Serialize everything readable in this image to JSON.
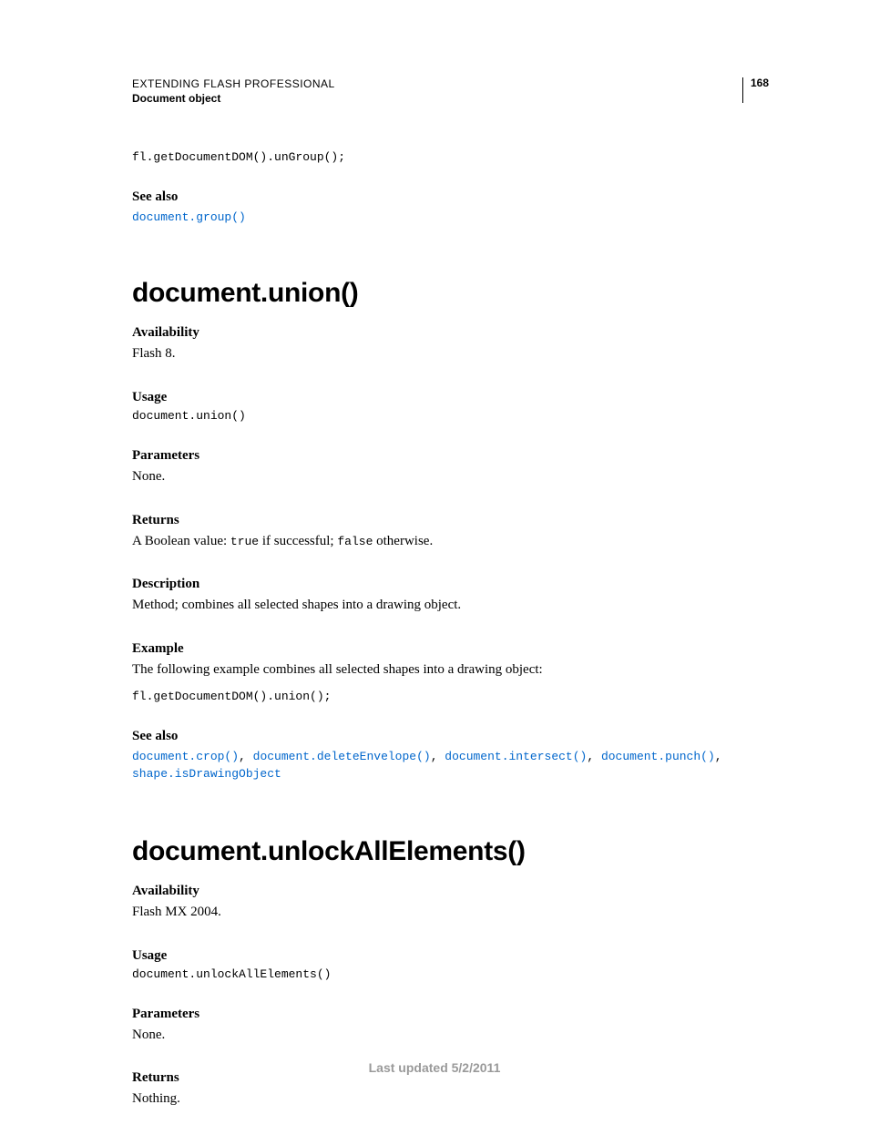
{
  "header": {
    "title": "EXTENDING FLASH PROFESSIONAL",
    "subtitle": "Document object",
    "page": "168"
  },
  "top_code": "fl.getDocumentDOM().unGroup();",
  "top_seealso_label": "See also",
  "top_seealso_link": "document.group()",
  "section1": {
    "title": "document.union()",
    "availability_label": "Availability",
    "availability_value": "Flash 8.",
    "usage_label": "Usage",
    "usage_code": "document.union()",
    "parameters_label": "Parameters",
    "parameters_value": "None.",
    "returns_label": "Returns",
    "returns_prefix": "A Boolean value: ",
    "returns_true": "true",
    "returns_mid": " if successful; ",
    "returns_false": "false",
    "returns_suffix": " otherwise.",
    "description_label": "Description",
    "description_value": "Method; combines all selected shapes into a drawing object.",
    "example_label": "Example",
    "example_text": "The following example combines all selected shapes into a drawing object:",
    "example_code": "fl.getDocumentDOM().union();",
    "seealso_label": "See also",
    "seealso_links": {
      "l1": "document.crop()",
      "l2": "document.deleteEnvelope()",
      "l3": "document.intersect()",
      "l4": "document.punch()",
      "l5": "shape.isDrawingObject"
    }
  },
  "section2": {
    "title": "document.unlockAllElements()",
    "availability_label": "Availability",
    "availability_value": "Flash MX 2004.",
    "usage_label": "Usage",
    "usage_code": "document.unlockAllElements()",
    "parameters_label": "Parameters",
    "parameters_value": "None.",
    "returns_label": "Returns",
    "returns_value": "Nothing."
  },
  "footer": "Last updated 5/2/2011"
}
